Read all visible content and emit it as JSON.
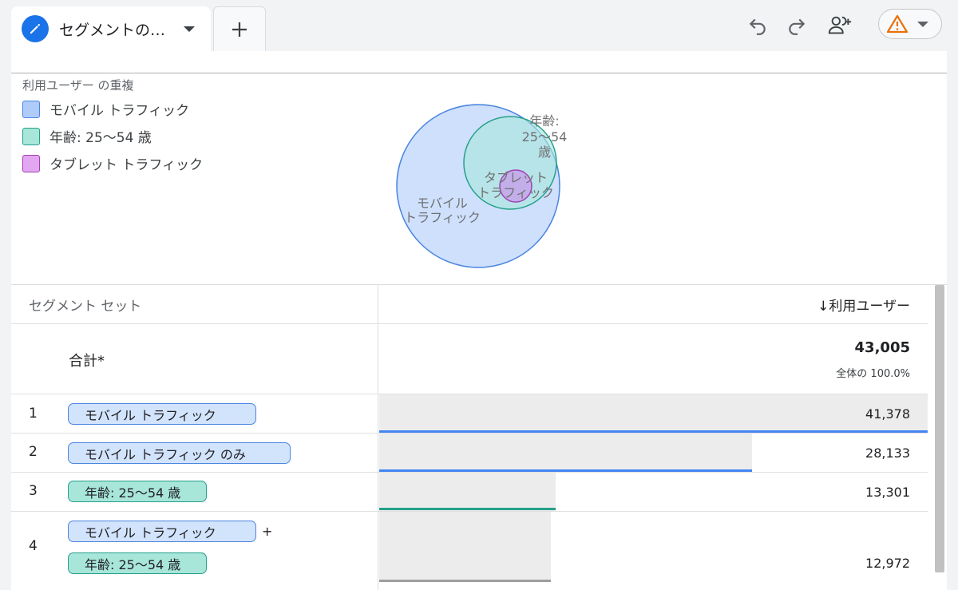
{
  "tab": {
    "label": "セグメントの…",
    "icon": "pencil-icon"
  },
  "toolbar": {
    "icons": [
      "add-tab-icon",
      "undo-icon",
      "redo-icon",
      "share-user-icon",
      "warning-icon"
    ]
  },
  "visualization": {
    "title": "利用ユーザー の重複",
    "legend": [
      {
        "label": "モバイル トラフィック",
        "color": "#aecbfa",
        "border": "#4a85e0"
      },
      {
        "label": "年齢: 25〜54 歳",
        "color": "#a8e6da",
        "border": "#26a08a"
      },
      {
        "label": "タブレット トラフィック",
        "color": "#e3a6f0",
        "border": "#a142b8"
      }
    ],
    "venn_labels": {
      "mobile": [
        "モバイル",
        "トラフィック"
      ],
      "age": [
        "年齢:",
        "25〜54",
        "歳"
      ],
      "tablet": [
        "タブレット",
        "トラフィック"
      ]
    }
  },
  "table": {
    "header_left": "セグメント セット",
    "header_right": "↓利用ユーザー",
    "total": {
      "label": "合計*",
      "value": "43,005",
      "sub": "全体の 100.0%"
    },
    "plus": "+",
    "rows": [
      {
        "num": "1",
        "chips": [
          "モバイル トラフィック"
        ],
        "value": "41,378",
        "share": 0.9622,
        "bar_color": "#4285f4"
      },
      {
        "num": "2",
        "chips": [
          "モバイル トラフィック のみ"
        ],
        "value": "28,133",
        "share": 0.6542,
        "bar_color": "#4285f4"
      },
      {
        "num": "3",
        "chips": [
          "年齢: 25〜54 歳"
        ],
        "value": "13,301",
        "share": 0.3093,
        "bar_color": "#26a08a"
      },
      {
        "num": "4",
        "chips": [
          "モバイル トラフィック",
          "年齢: 25〜54 歳"
        ],
        "value": "12,972",
        "share": 0.3016,
        "bar_color": "#9e9e9e"
      }
    ]
  }
}
